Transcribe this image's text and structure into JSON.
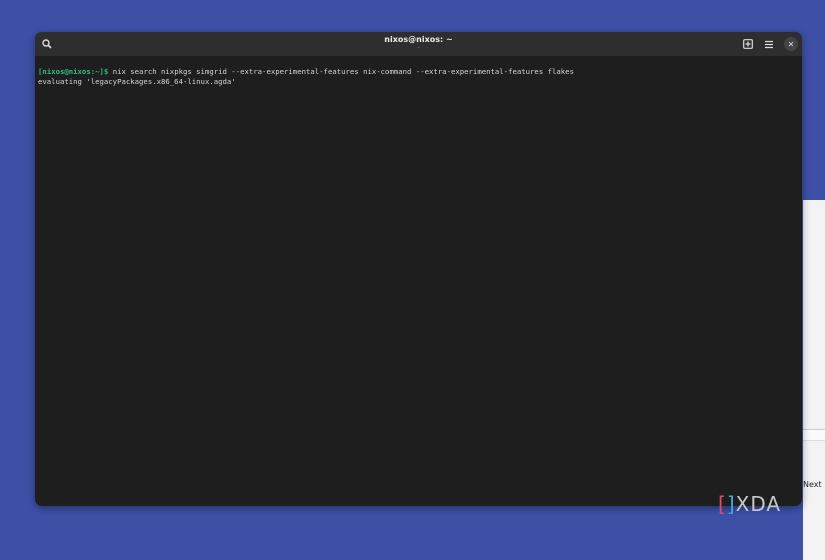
{
  "window": {
    "title": "nixos@nixos: ~",
    "subtitle": "-"
  },
  "terminal": {
    "prompt": "[nixos@nixos:~]$",
    "command": " nix search nixpkgs simgrid --extra-experimental-features nix-command --extra-experimental-features flakes",
    "output": "evaluating 'legacyPackages.x86_64-linux.agda'"
  },
  "background_window": {
    "button_label": "Next"
  },
  "watermark": {
    "bracket_left": "[",
    "bracket_right": "]",
    "text": "XDA"
  }
}
